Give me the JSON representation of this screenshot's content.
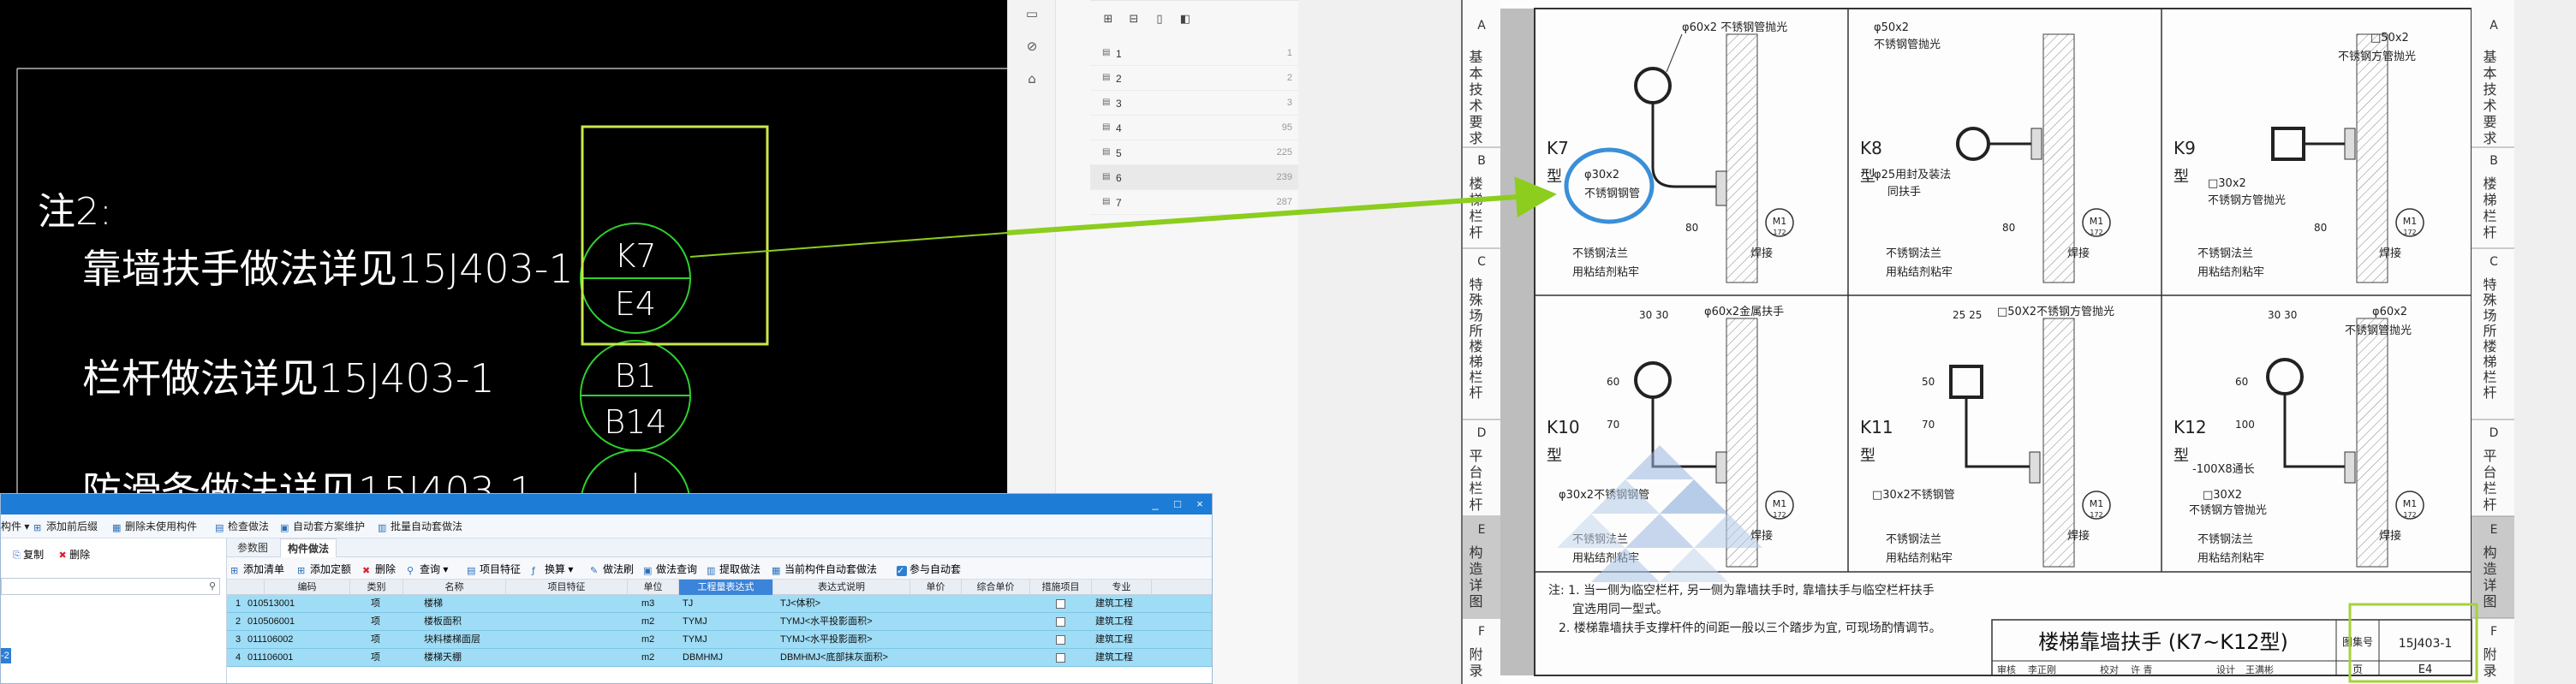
{
  "cad": {
    "note_title": "注2:",
    "note_lines": [
      "靠墙扶手做法详见15J403-1",
      "栏杆做法详见15J403-1",
      "防滑条做法详见15J403-1"
    ],
    "symbols": [
      {
        "top": "K7",
        "bottom": "E4"
      },
      {
        "top": "B1",
        "bottom": "B14"
      },
      {
        "top": "J",
        "bottom": ""
      }
    ],
    "colors": {
      "background": "#000000",
      "text": "#ffffff",
      "symbol": "#2fd12f",
      "highlight_box": "#c8e84a",
      "arrow": "#8ccd1e",
      "callout_circle": "#3a8fd8"
    }
  },
  "pdf_sidebar": {
    "icons": [
      "comment-icon",
      "attachment-icon",
      "stamp-icon"
    ],
    "toolbar": [
      "expand-all-icon",
      "collapse-all-icon",
      "bookmark-add-icon",
      "bookmark-icon"
    ],
    "bookmarks": [
      {
        "label": "1",
        "page": "1"
      },
      {
        "label": "2",
        "page": "2"
      },
      {
        "label": "3",
        "page": "3"
      },
      {
        "label": "4",
        "page": "95"
      },
      {
        "label": "5",
        "page": "225"
      },
      {
        "label": "6",
        "page": "239"
      },
      {
        "label": "7",
        "page": "287"
      }
    ],
    "selected_index": 5
  },
  "sheet": {
    "side_tabs_left": [
      {
        "letter": "A",
        "text": "基本技术要求"
      },
      {
        "letter": "B",
        "text": "楼梯栏杆"
      },
      {
        "letter": "C",
        "text": "特殊场所楼梯栏杆"
      },
      {
        "letter": "D",
        "text": "平台栏杆"
      },
      {
        "letter": "E",
        "text": "构造详图"
      },
      {
        "letter": "F",
        "text": "附录"
      }
    ],
    "side_tabs_right": [
      {
        "letter": "A",
        "text": "基本技术要求"
      },
      {
        "letter": "B",
        "text": "楼梯栏杆"
      },
      {
        "letter": "C",
        "text": "特殊场所楼梯栏杆"
      },
      {
        "letter": "D",
        "text": "平台栏杆"
      },
      {
        "letter": "E",
        "text": "构造详图"
      },
      {
        "letter": "F",
        "text": "附录"
      }
    ],
    "panels": [
      {
        "type_label": "K7",
        "suffix": "型",
        "tube": "φ60x2 不锈钢管抛光",
        "tube2": "φ30x2",
        "tube3": "不锈钢钢管",
        "flange": "不锈钢法兰",
        "glue": "用粘结剂粘牢",
        "weld": "焊接",
        "dim": "80"
      },
      {
        "type_label": "K8",
        "suffix": "型",
        "tube": "φ50x2",
        "tube2": "不锈钢管抛光",
        "tube3": "φ25用封及装法",
        "tube4": "同扶手",
        "flange": "不锈钢法兰",
        "glue": "用粘结剂粘牢",
        "weld": "焊接",
        "dim": "80"
      },
      {
        "type_label": "K9",
        "suffix": "型",
        "tube": "□50x2",
        "tube2": "不锈钢方管抛光",
        "tube3": "□30x2",
        "tube4": "不锈钢方管抛光",
        "flange": "不锈钢法兰",
        "glue": "用粘结剂粘牢",
        "weld": "焊接",
        "dim": "80"
      },
      {
        "type_label": "K10",
        "suffix": "型",
        "tube": "φ60x2金属扶手",
        "tube2": "φ30x2不锈钢钢管",
        "flange": "不锈钢法兰",
        "glue": "用粘结剂粘牢",
        "weld": "焊接",
        "dim": "30 30",
        "dim2": "60",
        "dim3": "70"
      },
      {
        "type_label": "K11",
        "suffix": "型",
        "tube": "□50X2不锈钢方管抛光",
        "tube2": "□30x2不锈钢管",
        "flange": "不锈钢法兰",
        "glue": "用粘结剂粘牢",
        "weld": "焊接",
        "dim": "25 25",
        "dim2": "50",
        "dim3": "70"
      },
      {
        "type_label": "K12",
        "suffix": "型",
        "tube": "φ60x2",
        "tube2": "不锈钢管抛光",
        "tube3": "-100X8通长",
        "tube4": "□30X2",
        "tube5": "不锈钢方管抛光",
        "flange": "不锈钢法兰",
        "glue": "用粘结剂粘牢",
        "weld": "焊接",
        "dim": "30 30",
        "dim2": "60",
        "dim3": "100"
      }
    ],
    "anchor_label": "M1",
    "anchor_sub": "172",
    "notes": [
      "注: 1. 当一侧为临空栏杆, 另一侧为靠墙扶手时, 靠墙扶手与临空栏杆扶手",
      "宜选用同一型式。",
      "2. 楼梯靠墙扶手支撑杆件的间距一般以三个踏步为宜, 可现场酌情调节。"
    ],
    "title": "楼梯靠墙扶手 (K7~K12型)",
    "atlas_label": "图集号",
    "atlas_no": "15J403-1",
    "page_label": "页",
    "page_no": "E4",
    "signature_row": [
      "审核",
      "李正刚",
      "校对",
      "许 青",
      "设计",
      "王满彬"
    ]
  },
  "window": {
    "title_controls": [
      "_",
      "□",
      "×"
    ],
    "toolbar1": [
      "构件 ▾",
      "添加前后缀",
      "删除未使用构件",
      "检查做法",
      "自动套方案维护",
      "批量自动套做法"
    ],
    "left_tools": [
      "复制",
      "删除"
    ],
    "left_node": "-2",
    "tabs": [
      "参数图",
      "构件做法"
    ],
    "active_tab": 1,
    "toolbar2": [
      "添加清单",
      "添加定额",
      "删除",
      "查询 ▾",
      "项目特征",
      "换算 ▾",
      "做法刷",
      "做法查询",
      "提取做法",
      "当前构件自动套做法",
      "参与自动套"
    ],
    "columns": [
      "编码",
      "类别",
      "名称",
      "项目特征",
      "单位",
      "工程量表达式",
      "表达式说明",
      "单价",
      "综合单价",
      "措施项目",
      "专业"
    ],
    "highlight_column": 5,
    "rows": [
      {
        "n": "1",
        "code": "010513001",
        "kind": "项",
        "name": "楼梯",
        "feature": "",
        "unit": "m3",
        "expr": "TJ",
        "desc": "TJ<体积>",
        "major": "建筑工程"
      },
      {
        "n": "2",
        "code": "010506001",
        "kind": "项",
        "name": "楼板面积",
        "feature": "",
        "unit": "m2",
        "expr": "TYMJ",
        "desc": "TYMJ<水平投影面积>",
        "major": "建筑工程"
      },
      {
        "n": "3",
        "code": "011106002",
        "kind": "项",
        "name": "块料楼梯面层",
        "feature": "",
        "unit": "m2",
        "expr": "TYMJ",
        "desc": "TYMJ<水平投影面积>",
        "major": "建筑工程"
      },
      {
        "n": "4",
        "code": "011106001",
        "kind": "项",
        "name": "楼梯天棚",
        "feature": "",
        "unit": "m2",
        "expr": "DBMHMJ",
        "desc": "DBMHMJ<底部抹灰面积>",
        "major": "建筑工程"
      }
    ],
    "colors": {
      "title_bar": "#1d7cd6",
      "row_bg": "#9fdcf5",
      "header_hl": "#3b84d9"
    }
  }
}
